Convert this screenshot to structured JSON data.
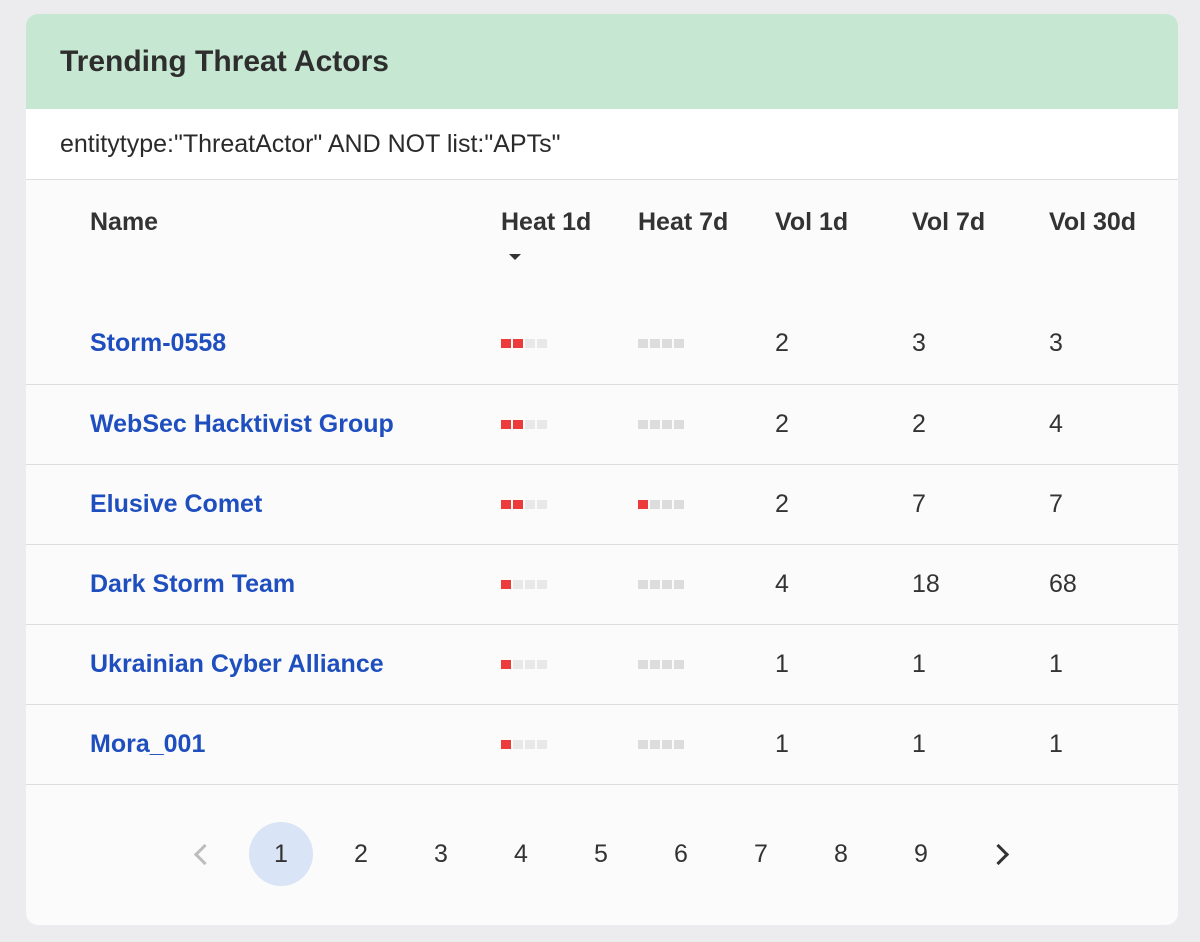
{
  "card": {
    "title": "Trending Threat Actors",
    "query": "entitytype:\"ThreatActor\" AND NOT list:\"APTs\""
  },
  "table": {
    "columns": [
      "Name",
      "Heat 1d",
      "Heat 7d",
      "Vol 1d",
      "Vol 7d",
      "Vol 30d"
    ],
    "sorted_column": "Heat 1d",
    "sort_direction": "descending",
    "rows": [
      {
        "name": "Storm-0558",
        "heat_1d": 2,
        "heat_7d": 0,
        "vol_1d": "2",
        "vol_7d": "3",
        "vol_30d": "3"
      },
      {
        "name": "WebSec Hacktivist Group",
        "heat_1d": 2,
        "heat_7d": 0,
        "vol_1d": "2",
        "vol_7d": "2",
        "vol_30d": "4"
      },
      {
        "name": "Elusive Comet",
        "heat_1d": 2,
        "heat_7d": 1,
        "vol_1d": "2",
        "vol_7d": "7",
        "vol_30d": "7"
      },
      {
        "name": "Dark Storm Team",
        "heat_1d": 1,
        "heat_7d": 0,
        "vol_1d": "4",
        "vol_7d": "18",
        "vol_30d": "68"
      },
      {
        "name": "Ukrainian Cyber Alliance",
        "heat_1d": 1,
        "heat_7d": 0,
        "vol_1d": "1",
        "vol_7d": "1",
        "vol_30d": "1"
      },
      {
        "name": "Mora_001",
        "heat_1d": 1,
        "heat_7d": 0,
        "vol_1d": "1",
        "vol_7d": "1",
        "vol_30d": "1"
      }
    ],
    "heat_scale_max": 4
  },
  "pagination": {
    "pages": [
      "1",
      "2",
      "3",
      "4",
      "5",
      "6",
      "7",
      "8",
      "9"
    ],
    "current": "1",
    "prev_icon": "chevron-left-icon",
    "next_icon": "chevron-right-icon"
  },
  "colors": {
    "header_bg": "#c6e7d2",
    "link": "#1f4fbf",
    "heat_on": "#ec3b3b",
    "active_page_bg": "#d9e4f6"
  }
}
